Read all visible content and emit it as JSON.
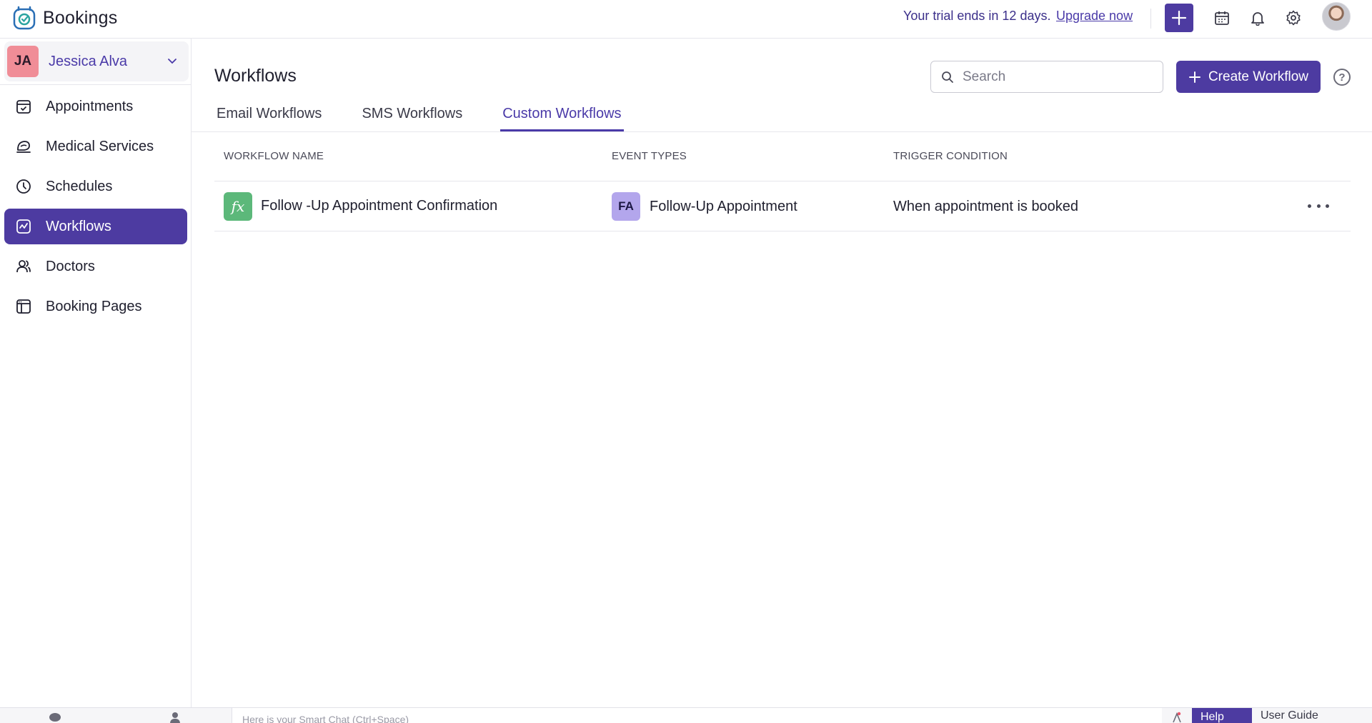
{
  "app": {
    "name": "Bookings"
  },
  "topbar": {
    "trial_text": "Your trial ends in 12 days.",
    "upgrade_link": "Upgrade now"
  },
  "account": {
    "initials": "JA",
    "name": "Jessica Alva"
  },
  "sidebar": {
    "items": [
      {
        "label": "Appointments",
        "icon": "calendar-check-icon",
        "active": false
      },
      {
        "label": "Medical Services",
        "icon": "services-icon",
        "active": false
      },
      {
        "label": "Schedules",
        "icon": "clock-icon",
        "active": false
      },
      {
        "label": "Workflows",
        "icon": "workflow-icon",
        "active": true
      },
      {
        "label": "Doctors",
        "icon": "users-icon",
        "active": false
      },
      {
        "label": "Booking Pages",
        "icon": "booking-page-icon",
        "active": false
      }
    ]
  },
  "main": {
    "title": "Workflows",
    "search_placeholder": "Search",
    "create_button": "Create Workflow",
    "tabs": [
      {
        "label": "Email Workflows",
        "active": false
      },
      {
        "label": "SMS Workflows",
        "active": false
      },
      {
        "label": "Custom Workflows",
        "active": true
      }
    ],
    "table": {
      "columns": [
        "WORKFLOW NAME",
        "EVENT TYPES",
        "TRIGGER CONDITION"
      ],
      "rows": [
        {
          "workflow_name": "Follow -Up Appointment Confirmation",
          "workflow_icon_text": "fx",
          "event_badge": "FA",
          "event_type": "Follow-Up Appointment",
          "trigger": "When appointment is booked"
        }
      ]
    }
  },
  "bottombar": {
    "smart_chat_placeholder": "Here is your Smart Chat (Ctrl+Space)",
    "help": "Help",
    "user_guide": "User Guide"
  },
  "colors": {
    "accent": "#4d3ba1",
    "link": "#4a3aa8",
    "account_badge": "#f08d97",
    "fx_badge": "#5cb87a",
    "event_badge": "#b3a6ec"
  }
}
